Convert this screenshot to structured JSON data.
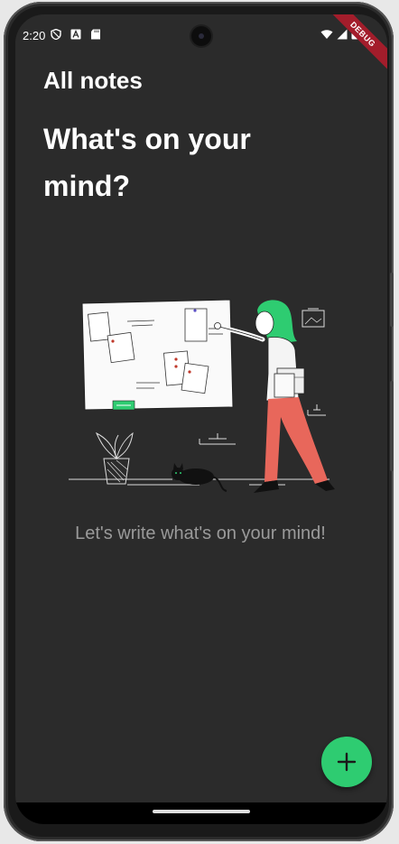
{
  "status_bar": {
    "time": "2:20",
    "icons": [
      "shield-icon",
      "a-icon",
      "sd-card-icon",
      "wifi-icon",
      "signal-icon",
      "battery-icon"
    ]
  },
  "debug_banner": "DEBUG",
  "header": {
    "title": "All notes"
  },
  "main": {
    "heading": "What's on your mind?",
    "empty_message": "Let's write what's on your mind!"
  },
  "fab": {
    "icon": "plus-icon"
  },
  "colors": {
    "background": "#2b2b2b",
    "accent": "#2ecc71",
    "illustration_hair": "#2ecc71",
    "illustration_pants": "#e8675b",
    "debug_banner": "#a31d2b"
  }
}
